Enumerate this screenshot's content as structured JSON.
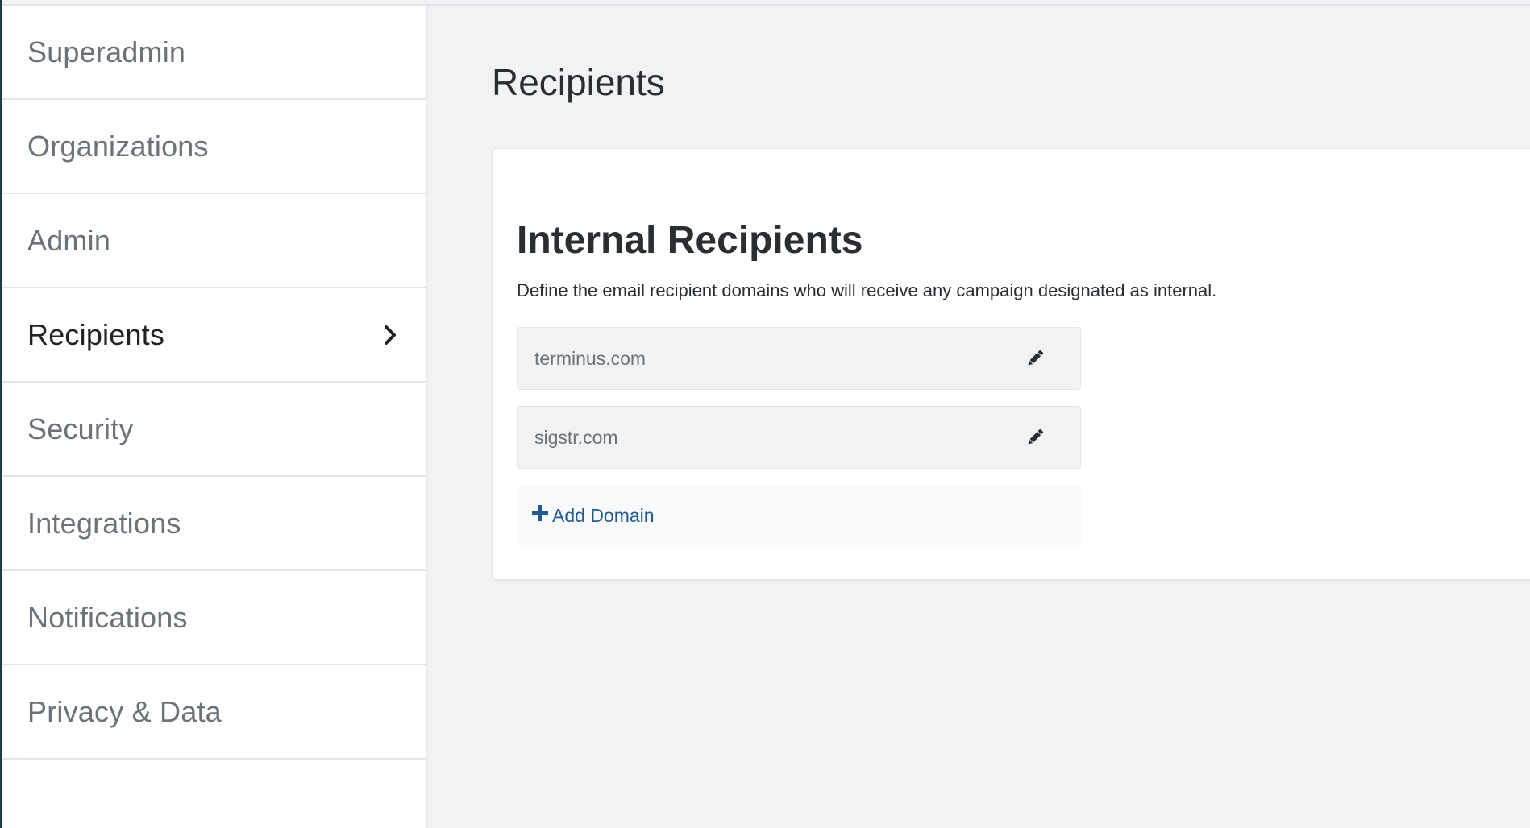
{
  "sidebar": {
    "items": [
      {
        "label": "Superadmin"
      },
      {
        "label": "Organizations"
      },
      {
        "label": "Admin"
      },
      {
        "label": "Recipients"
      },
      {
        "label": "Security"
      },
      {
        "label": "Integrations"
      },
      {
        "label": "Notifications"
      },
      {
        "label": "Privacy & Data"
      }
    ],
    "active_item": "Recipients"
  },
  "main": {
    "page_title": "Recipients",
    "card": {
      "title": "Internal Recipients",
      "description": "Define the email recipient domains who will receive any campaign designated as internal.",
      "domains": [
        {
          "value": "terminus.com"
        },
        {
          "value": "sigstr.com"
        }
      ],
      "add_label": "Add Domain"
    }
  },
  "icons": {
    "active_indicator": "chevron-right-icon",
    "edit": "pencil-icon",
    "add": "plus-icon"
  },
  "colors": {
    "link": "#1f5b8f",
    "sidebar_edge": "#1f3a44",
    "background": "#f1f2f4"
  }
}
